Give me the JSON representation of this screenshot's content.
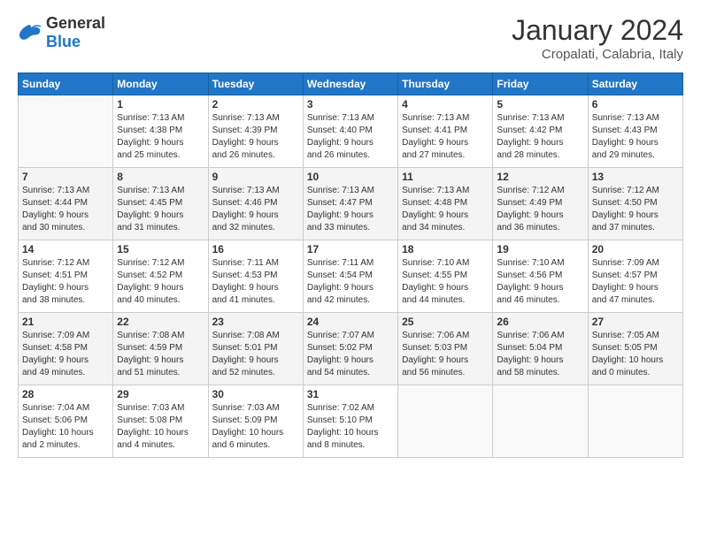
{
  "logo": {
    "general": "General",
    "blue": "Blue"
  },
  "header": {
    "month": "January 2024",
    "location": "Cropalati, Calabria, Italy"
  },
  "days_of_week": [
    "Sunday",
    "Monday",
    "Tuesday",
    "Wednesday",
    "Thursday",
    "Friday",
    "Saturday"
  ],
  "weeks": [
    [
      {
        "day": "",
        "info": ""
      },
      {
        "day": "1",
        "info": "Sunrise: 7:13 AM\nSunset: 4:38 PM\nDaylight: 9 hours\nand 25 minutes."
      },
      {
        "day": "2",
        "info": "Sunrise: 7:13 AM\nSunset: 4:39 PM\nDaylight: 9 hours\nand 26 minutes."
      },
      {
        "day": "3",
        "info": "Sunrise: 7:13 AM\nSunset: 4:40 PM\nDaylight: 9 hours\nand 26 minutes."
      },
      {
        "day": "4",
        "info": "Sunrise: 7:13 AM\nSunset: 4:41 PM\nDaylight: 9 hours\nand 27 minutes."
      },
      {
        "day": "5",
        "info": "Sunrise: 7:13 AM\nSunset: 4:42 PM\nDaylight: 9 hours\nand 28 minutes."
      },
      {
        "day": "6",
        "info": "Sunrise: 7:13 AM\nSunset: 4:43 PM\nDaylight: 9 hours\nand 29 minutes."
      }
    ],
    [
      {
        "day": "7",
        "info": "Sunrise: 7:13 AM\nSunset: 4:44 PM\nDaylight: 9 hours\nand 30 minutes."
      },
      {
        "day": "8",
        "info": "Sunrise: 7:13 AM\nSunset: 4:45 PM\nDaylight: 9 hours\nand 31 minutes."
      },
      {
        "day": "9",
        "info": "Sunrise: 7:13 AM\nSunset: 4:46 PM\nDaylight: 9 hours\nand 32 minutes."
      },
      {
        "day": "10",
        "info": "Sunrise: 7:13 AM\nSunset: 4:47 PM\nDaylight: 9 hours\nand 33 minutes."
      },
      {
        "day": "11",
        "info": "Sunrise: 7:13 AM\nSunset: 4:48 PM\nDaylight: 9 hours\nand 34 minutes."
      },
      {
        "day": "12",
        "info": "Sunrise: 7:12 AM\nSunset: 4:49 PM\nDaylight: 9 hours\nand 36 minutes."
      },
      {
        "day": "13",
        "info": "Sunrise: 7:12 AM\nSunset: 4:50 PM\nDaylight: 9 hours\nand 37 minutes."
      }
    ],
    [
      {
        "day": "14",
        "info": "Sunrise: 7:12 AM\nSunset: 4:51 PM\nDaylight: 9 hours\nand 38 minutes."
      },
      {
        "day": "15",
        "info": "Sunrise: 7:12 AM\nSunset: 4:52 PM\nDaylight: 9 hours\nand 40 minutes."
      },
      {
        "day": "16",
        "info": "Sunrise: 7:11 AM\nSunset: 4:53 PM\nDaylight: 9 hours\nand 41 minutes."
      },
      {
        "day": "17",
        "info": "Sunrise: 7:11 AM\nSunset: 4:54 PM\nDaylight: 9 hours\nand 42 minutes."
      },
      {
        "day": "18",
        "info": "Sunrise: 7:10 AM\nSunset: 4:55 PM\nDaylight: 9 hours\nand 44 minutes."
      },
      {
        "day": "19",
        "info": "Sunrise: 7:10 AM\nSunset: 4:56 PM\nDaylight: 9 hours\nand 46 minutes."
      },
      {
        "day": "20",
        "info": "Sunrise: 7:09 AM\nSunset: 4:57 PM\nDaylight: 9 hours\nand 47 minutes."
      }
    ],
    [
      {
        "day": "21",
        "info": "Sunrise: 7:09 AM\nSunset: 4:58 PM\nDaylight: 9 hours\nand 49 minutes."
      },
      {
        "day": "22",
        "info": "Sunrise: 7:08 AM\nSunset: 4:59 PM\nDaylight: 9 hours\nand 51 minutes."
      },
      {
        "day": "23",
        "info": "Sunrise: 7:08 AM\nSunset: 5:01 PM\nDaylight: 9 hours\nand 52 minutes."
      },
      {
        "day": "24",
        "info": "Sunrise: 7:07 AM\nSunset: 5:02 PM\nDaylight: 9 hours\nand 54 minutes."
      },
      {
        "day": "25",
        "info": "Sunrise: 7:06 AM\nSunset: 5:03 PM\nDaylight: 9 hours\nand 56 minutes."
      },
      {
        "day": "26",
        "info": "Sunrise: 7:06 AM\nSunset: 5:04 PM\nDaylight: 9 hours\nand 58 minutes."
      },
      {
        "day": "27",
        "info": "Sunrise: 7:05 AM\nSunset: 5:05 PM\nDaylight: 10 hours\nand 0 minutes."
      }
    ],
    [
      {
        "day": "28",
        "info": "Sunrise: 7:04 AM\nSunset: 5:06 PM\nDaylight: 10 hours\nand 2 minutes."
      },
      {
        "day": "29",
        "info": "Sunrise: 7:03 AM\nSunset: 5:08 PM\nDaylight: 10 hours\nand 4 minutes."
      },
      {
        "day": "30",
        "info": "Sunrise: 7:03 AM\nSunset: 5:09 PM\nDaylight: 10 hours\nand 6 minutes."
      },
      {
        "day": "31",
        "info": "Sunrise: 7:02 AM\nSunset: 5:10 PM\nDaylight: 10 hours\nand 8 minutes."
      },
      {
        "day": "",
        "info": ""
      },
      {
        "day": "",
        "info": ""
      },
      {
        "day": "",
        "info": ""
      }
    ]
  ]
}
